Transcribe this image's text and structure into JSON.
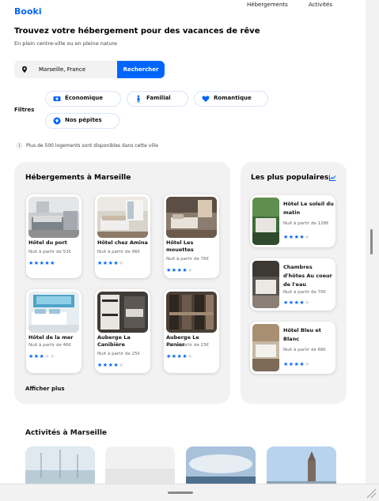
{
  "header": {
    "logo": "Booki",
    "nav": [
      "Hébergements",
      "Activités"
    ]
  },
  "hero": {
    "title": "Trouvez votre hébergement pour des vacances de rêve",
    "subtitle": "En plein centre-ville ou en pleine nature"
  },
  "search": {
    "value": "Marseille, France",
    "button_label": "Rechercher",
    "icon": "map-pin-icon"
  },
  "filters": {
    "label": "Filtres",
    "items": [
      {
        "label": "Économique",
        "icon": "money-icon"
      },
      {
        "label": "Familial",
        "icon": "child-icon"
      },
      {
        "label": "Romantique",
        "icon": "heart-icon"
      },
      {
        "label": "Nos pépites",
        "icon": "gem-icon"
      }
    ]
  },
  "info": {
    "text": "Plus de 500 logements sont disponibles dans cette ville"
  },
  "accommodations": {
    "title": "Hébergements à Marseille",
    "items": [
      {
        "name": "Hôtel du port",
        "price": "Nuit à partir de 52€",
        "rating": 5
      },
      {
        "name": "Hôtel chez Amina",
        "price": "Nuit à partir de 96€",
        "rating": 4
      },
      {
        "name": "Hôtel Les mouettes",
        "price": "Nuit à partir de 76€",
        "rating": 4
      },
      {
        "name": "Hôtel de la mer",
        "price": "Nuit à partir de 46€",
        "rating": 3
      },
      {
        "name": "Auberge La Canibière",
        "price": "Nuit à partir de 25€",
        "rating": 4
      },
      {
        "name": "Auberge Le Panier",
        "price": "Nuit à partir de 23€",
        "rating": 4
      }
    ],
    "more_label": "Afficher plus"
  },
  "popular": {
    "title": "Les plus populaires",
    "icon": "trend-chart-icon",
    "items": [
      {
        "name": "Hôtel Le soleil du matin",
        "price": "Nuit à partir de 128€",
        "rating": 4
      },
      {
        "name": "Chambres d'hôtes Au coeur de l'eau",
        "price": "Nuit à partir de 70€",
        "rating": 4
      },
      {
        "name": "Hôtel Bleu et Blanc",
        "price": "Nuit à partir de 68€",
        "rating": 4
      }
    ]
  },
  "activities": {
    "title": "Activités à Marseille"
  },
  "colors": {
    "primary": "#0065fc",
    "panel": "#f2f2f2",
    "star_off": "#d6d6d6"
  }
}
